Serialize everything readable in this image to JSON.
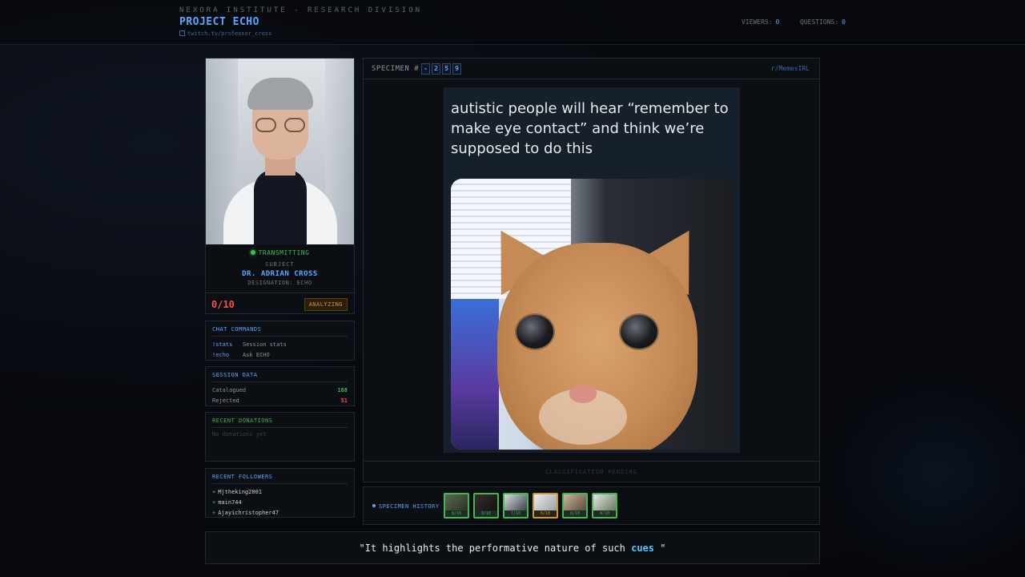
{
  "header": {
    "org": "NEXORA INSTITUTE - RESEARCH DIVISION",
    "title": "PROJECT ECHO",
    "link": "twitch.tv/professor_cross",
    "viewers_label": "VIEWERS:",
    "viewers_value": "0",
    "questions_label": "QUESTIONS:",
    "questions_value": "0"
  },
  "subject": {
    "status": "TRANSMITTING",
    "label": "SUBJECT",
    "name": "DR. ADRIAN CROSS",
    "designation": "DESIGNATION: ECHO",
    "score": "0/10",
    "state_badge": "ANALYZING"
  },
  "chat_commands": {
    "title": "CHAT COMMANDS",
    "items": [
      {
        "cmd": "!stats",
        "desc": "Session stats"
      },
      {
        "cmd": "!echo",
        "desc": "Ask ECHO"
      }
    ]
  },
  "session_data": {
    "title": "SESSION DATA",
    "catalogued_label": "Catalogued",
    "catalogued_value": "168",
    "rejected_label": "Rejected",
    "rejected_value": "51"
  },
  "donations": {
    "title": "RECENT DONATIONS",
    "empty": "No donations yet"
  },
  "followers": {
    "title": "RECENT FOLLOWERS",
    "items": [
      "Mjtheking2001",
      "main744",
      "Ajayichristopher47"
    ]
  },
  "specimen": {
    "label": "SPECIMEN #",
    "digits": [
      "-",
      "2",
      "5",
      "9"
    ],
    "source": "r/MemesIRL",
    "meme_text": "autistic people will hear “remember to make eye contact” and think we’re supposed to do this",
    "classification": "CLASSIFICATION PENDING"
  },
  "history": {
    "label": "SPECIMEN HISTORY",
    "items": [
      {
        "score": "8/10",
        "status": "good"
      },
      {
        "score": "9/10",
        "status": "good"
      },
      {
        "score": "7/10",
        "status": "good"
      },
      {
        "score": "6/10",
        "status": "warn"
      },
      {
        "score": "8/10",
        "status": "good"
      },
      {
        "score": "8/10",
        "status": "good"
      }
    ]
  },
  "quote": {
    "prefix": "\"It highlights the performative nature of such ",
    "highlight": "cues",
    "suffix": " \""
  },
  "colors": {
    "accent": "#58a6ff",
    "good": "#3fb950",
    "bad": "#f85149",
    "warn": "#d29922"
  }
}
